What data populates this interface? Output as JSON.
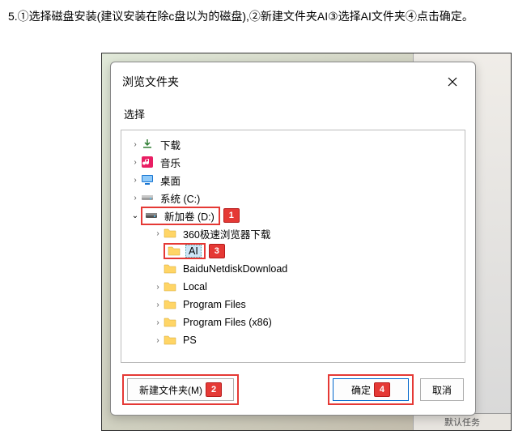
{
  "instruction": "5.①选择磁盘安装(建议安装在除c盘以为的磁盘),②新建文件夹AI③选择AI文件夹④点击确定。",
  "dialog": {
    "title": "浏览文件夹",
    "subtitle": "选择",
    "tree": {
      "downloads": "下载",
      "music": "音乐",
      "desktop": "桌面",
      "cdrive": "系统 (C:)",
      "ddrive": "新加卷 (D:)",
      "d_children": {
        "browser": "360极速浏览器下载",
        "ai": "AI",
        "baidu": "BaiduNetdiskDownload",
        "local": "Local",
        "pf": "Program Files",
        "pf86": "Program Files (x86)",
        "ps": "PS"
      }
    },
    "buttons": {
      "newfolder": "新建文件夹(M)",
      "ok": "确定",
      "cancel": "取消"
    }
  },
  "annotation": {
    "n1": "1",
    "n2": "2",
    "n3": "3",
    "n4": "4"
  },
  "backdrop_footer": "默认任务"
}
